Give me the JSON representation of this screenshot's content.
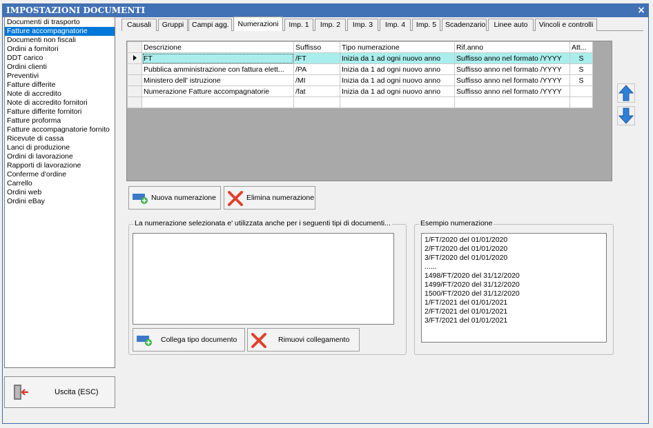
{
  "window": {
    "title": "IMPOSTAZIONI DOCUMENTI",
    "close_symbol": "×"
  },
  "doc_types": [
    "Documenti di trasporto",
    "Fatture accompagnatorie",
    "Documenti non fiscali",
    "Ordini a fornitori",
    "DDT carico",
    "Ordini clienti",
    "Preventivi",
    "Fatture differite",
    "Note di accredito",
    "Note di accredito fornitori",
    "Fatture differite fornitori",
    "Fatture proforma",
    "Fatture accompagnatorie fornito",
    "Ricevute di cassa",
    "Lanci di produzione",
    "Ordini di lavorazione",
    "Rapporti di lavorazione",
    "Conferme d'ordine",
    "Carrello",
    "Ordini web",
    "Ordini eBay"
  ],
  "selected_doc_type": "Fatture accompagnatorie",
  "exit_button": {
    "label": "Uscita (ESC)",
    "icon": "exit-door-icon"
  },
  "tabs": [
    "Causali",
    "Gruppi",
    "Campi agg.",
    "Numerazioni",
    "Imp. 1",
    "Imp. 2",
    "Imp. 3",
    "Imp. 4",
    "Imp. 5",
    "Scadenzario",
    "Linee auto",
    "Vincoli e controlli"
  ],
  "active_tab": "Numerazioni",
  "grid": {
    "columns": [
      "Descrizione",
      "Suffisso",
      "Tipo numerazione",
      "Rif.anno",
      "Att..."
    ],
    "rows": [
      {
        "descrizione": "FT",
        "suffisso": "/FT",
        "tipo": "Inizia da 1 ad ogni nuovo anno",
        "rif_anno": "Suffisso anno nel formato /YYYY",
        "att": "S"
      },
      {
        "descrizione": "Pubblica amministrazione con fattura elett...",
        "suffisso": "/PA",
        "tipo": "Inizia da 1 ad ogni nuovo anno",
        "rif_anno": "Suffisso anno nel formato /YYYY",
        "att": "S"
      },
      {
        "descrizione": "Ministero dell' istruzione",
        "suffisso": "/MI",
        "tipo": "Inizia da 1 ad ogni nuovo anno",
        "rif_anno": "Suffisso anno nel formato /YYYY",
        "att": "S"
      },
      {
        "descrizione": "Numerazione Fatture accompagnatorie",
        "suffisso": "/fat",
        "tipo": "Inizia da 1 ad ogni nuovo anno",
        "rif_anno": "Suffisso anno nel formato /YYYY",
        "att": ""
      }
    ]
  },
  "buttons": {
    "nuova": "Nuova numerazione",
    "elimina": "Elimina numerazione",
    "collega": "Collega tipo documento",
    "rimuovi": "Rimuovi collegamento"
  },
  "linked_group": {
    "title": "La numerazione selezionata e' utilizzata anche per i seguenti tipi di documenti..."
  },
  "example_group": {
    "title": "Esempio numerazione",
    "lines": [
      "1/FT/2020 del 01/01/2020",
      "2/FT/2020 del 01/01/2020",
      "3/FT/2020 del 01/01/2020",
      "......",
      "1498/FT/2020 del 31/12/2020",
      "1499/FT/2020 del 31/12/2020",
      "1500/FT/2020 del 31/12/2020",
      "1/FT/2021 del 01/01/2021",
      "2/FT/2021 del 01/01/2021",
      "3/FT/2021 del 01/01/2021"
    ]
  },
  "colors": {
    "titlebar": "#4272b6",
    "selection": "#0078d7",
    "row_highlight": "#aaeded",
    "arrow": "#2f7fd6",
    "delete_x": "#e0402a"
  }
}
